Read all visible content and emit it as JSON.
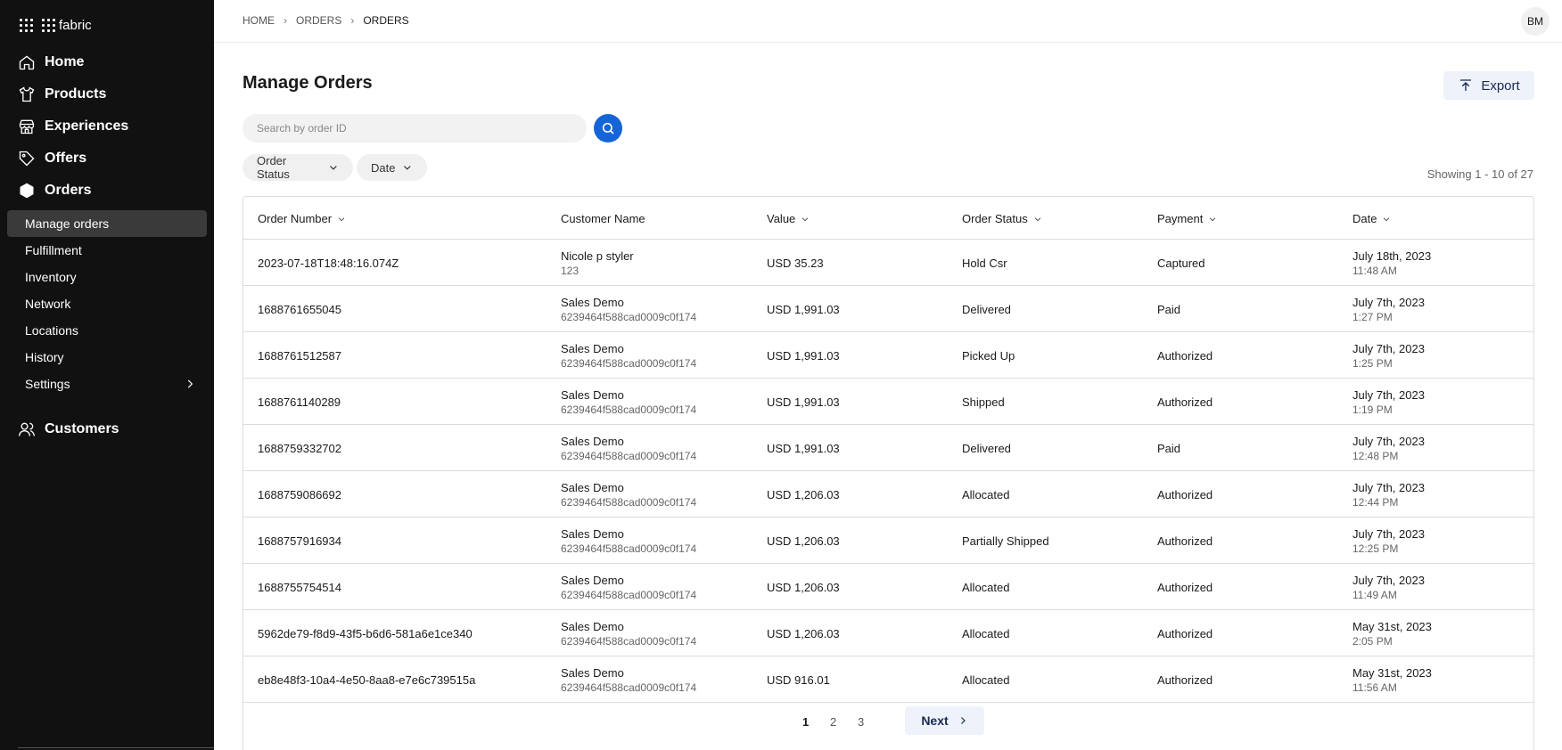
{
  "brand": {
    "name": "fabric"
  },
  "sidebar": {
    "nav": [
      {
        "key": "home",
        "label": "Home"
      },
      {
        "key": "products",
        "label": "Products"
      },
      {
        "key": "experiences",
        "label": "Experiences"
      },
      {
        "key": "offers",
        "label": "Offers"
      },
      {
        "key": "orders",
        "label": "Orders"
      }
    ],
    "orders_sub": [
      {
        "label": "Manage orders",
        "active": true
      },
      {
        "label": "Fulfillment"
      },
      {
        "label": "Inventory"
      },
      {
        "label": "Network"
      },
      {
        "label": "Locations"
      },
      {
        "label": "History"
      },
      {
        "label": "Settings"
      }
    ],
    "customers": "Customers"
  },
  "breadcrumb": [
    "HOME",
    "ORDERS",
    "ORDERS"
  ],
  "user": {
    "initials": "BM"
  },
  "page": {
    "title": "Manage Orders",
    "export_label": "Export",
    "search_placeholder": "Search by order ID",
    "filters": {
      "status": "Order Status",
      "date": "Date"
    },
    "showing": "Showing 1 - 10 of 27"
  },
  "table": {
    "columns": [
      "Order Number",
      "Customer Name",
      "Value",
      "Order Status",
      "Payment",
      "Date"
    ],
    "rows": [
      {
        "order": "2023-07-18T18:48:16.074Z",
        "customer": "Nicole p styler",
        "customer_id": "123",
        "value": "USD 35.23",
        "status": "Hold Csr",
        "payment": "Captured",
        "date": "July 18th, 2023",
        "time": "11:48 AM"
      },
      {
        "order": "1688761655045",
        "customer": "Sales Demo",
        "customer_id": "6239464f588cad0009c0f174",
        "value": "USD 1,991.03",
        "status": "Delivered",
        "payment": "Paid",
        "date": "July 7th, 2023",
        "time": "1:27 PM"
      },
      {
        "order": "1688761512587",
        "customer": "Sales Demo",
        "customer_id": "6239464f588cad0009c0f174",
        "value": "USD 1,991.03",
        "status": "Picked Up",
        "payment": "Authorized",
        "date": "July 7th, 2023",
        "time": "1:25 PM"
      },
      {
        "order": "1688761140289",
        "customer": "Sales Demo",
        "customer_id": "6239464f588cad0009c0f174",
        "value": "USD 1,991.03",
        "status": "Shipped",
        "payment": "Authorized",
        "date": "July 7th, 2023",
        "time": "1:19 PM"
      },
      {
        "order": "1688759332702",
        "customer": "Sales Demo",
        "customer_id": "6239464f588cad0009c0f174",
        "value": "USD 1,991.03",
        "status": "Delivered",
        "payment": "Paid",
        "date": "July 7th, 2023",
        "time": "12:48 PM"
      },
      {
        "order": "1688759086692",
        "customer": "Sales Demo",
        "customer_id": "6239464f588cad0009c0f174",
        "value": "USD 1,206.03",
        "status": "Allocated",
        "payment": "Authorized",
        "date": "July 7th, 2023",
        "time": "12:44 PM"
      },
      {
        "order": "1688757916934",
        "customer": "Sales Demo",
        "customer_id": "6239464f588cad0009c0f174",
        "value": "USD 1,206.03",
        "status": "Partially Shipped",
        "payment": "Authorized",
        "date": "July 7th, 2023",
        "time": "12:25 PM"
      },
      {
        "order": "1688755754514",
        "customer": "Sales Demo",
        "customer_id": "6239464f588cad0009c0f174",
        "value": "USD 1,206.03",
        "status": "Allocated",
        "payment": "Authorized",
        "date": "July 7th, 2023",
        "time": "11:49 AM"
      },
      {
        "order": "5962de79-f8d9-43f5-b6d6-581a6e1ce340",
        "customer": "Sales Demo",
        "customer_id": "6239464f588cad0009c0f174",
        "value": "USD 1,206.03",
        "status": "Allocated",
        "payment": "Authorized",
        "date": "May 31st, 2023",
        "time": "2:05 PM"
      },
      {
        "order": "eb8e48f3-10a4-4e50-8aa8-e7e6c739515a",
        "customer": "Sales Demo",
        "customer_id": "6239464f588cad0009c0f174",
        "value": "USD 916.01",
        "status": "Allocated",
        "payment": "Authorized",
        "date": "May 31st, 2023",
        "time": "11:56 AM"
      }
    ]
  },
  "pagination": {
    "pages": [
      "1",
      "2",
      "3"
    ],
    "current": "1",
    "next_label": "Next"
  },
  "colors": {
    "sidebar_bg": "#111111",
    "accent": "#1565d8",
    "button_bg": "#eef2fa"
  },
  "icons": {
    "home": "home-icon",
    "products": "shirt-icon",
    "experiences": "store-icon",
    "offers": "tag-icon",
    "orders": "hexagon-icon",
    "customers": "users-icon",
    "search": "search-icon",
    "export": "upload-icon",
    "chevron": "chevron-down-icon"
  }
}
